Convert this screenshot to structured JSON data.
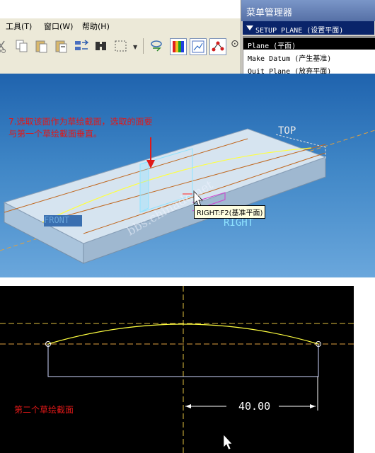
{
  "menubar": {
    "tools": "工具(T)",
    "window": "窗口(W)",
    "help": "帮助(H)"
  },
  "menu_manager": {
    "title": "菜单管理器",
    "header": "SETUP PLANE (设置平面)",
    "items": [
      {
        "label": "Plane (平面)",
        "active": true
      },
      {
        "label": "Make Datum (产生基准)",
        "active": false
      },
      {
        "label": "Quit Plane (放弃平面)",
        "active": false
      }
    ]
  },
  "viewport": {
    "annotation_line1": "7.选取该面作为草绘截面，选取的面要",
    "annotation_line2": "与第一个草绘截面垂直。",
    "datum_top": "TOP",
    "datum_right": "RIGHT",
    "datum_front": "FRONT",
    "tooltip": "RIGHT:F2(基准平面)",
    "watermark": "bbs.chinade.net"
  },
  "sketch": {
    "caption": "第二个草绘截面",
    "dimension": "40.00"
  },
  "colors": {
    "annotation_red": "#e01818",
    "datum_cyan": "#8fe3ff",
    "sketch_yellow": "#ffff40",
    "dim_white": "#ffffff",
    "centerline_yellow": "#e0c040",
    "edge_orange": "#c06820"
  },
  "icons": [
    "cut-icon",
    "copy-icon",
    "paste-icon",
    "paste-special-icon",
    "regenerate-icon",
    "find-icon",
    "select-box-icon",
    "orient-icon",
    "color-appearance-icon",
    "model-tree-icon",
    "datum-display-icon"
  ]
}
